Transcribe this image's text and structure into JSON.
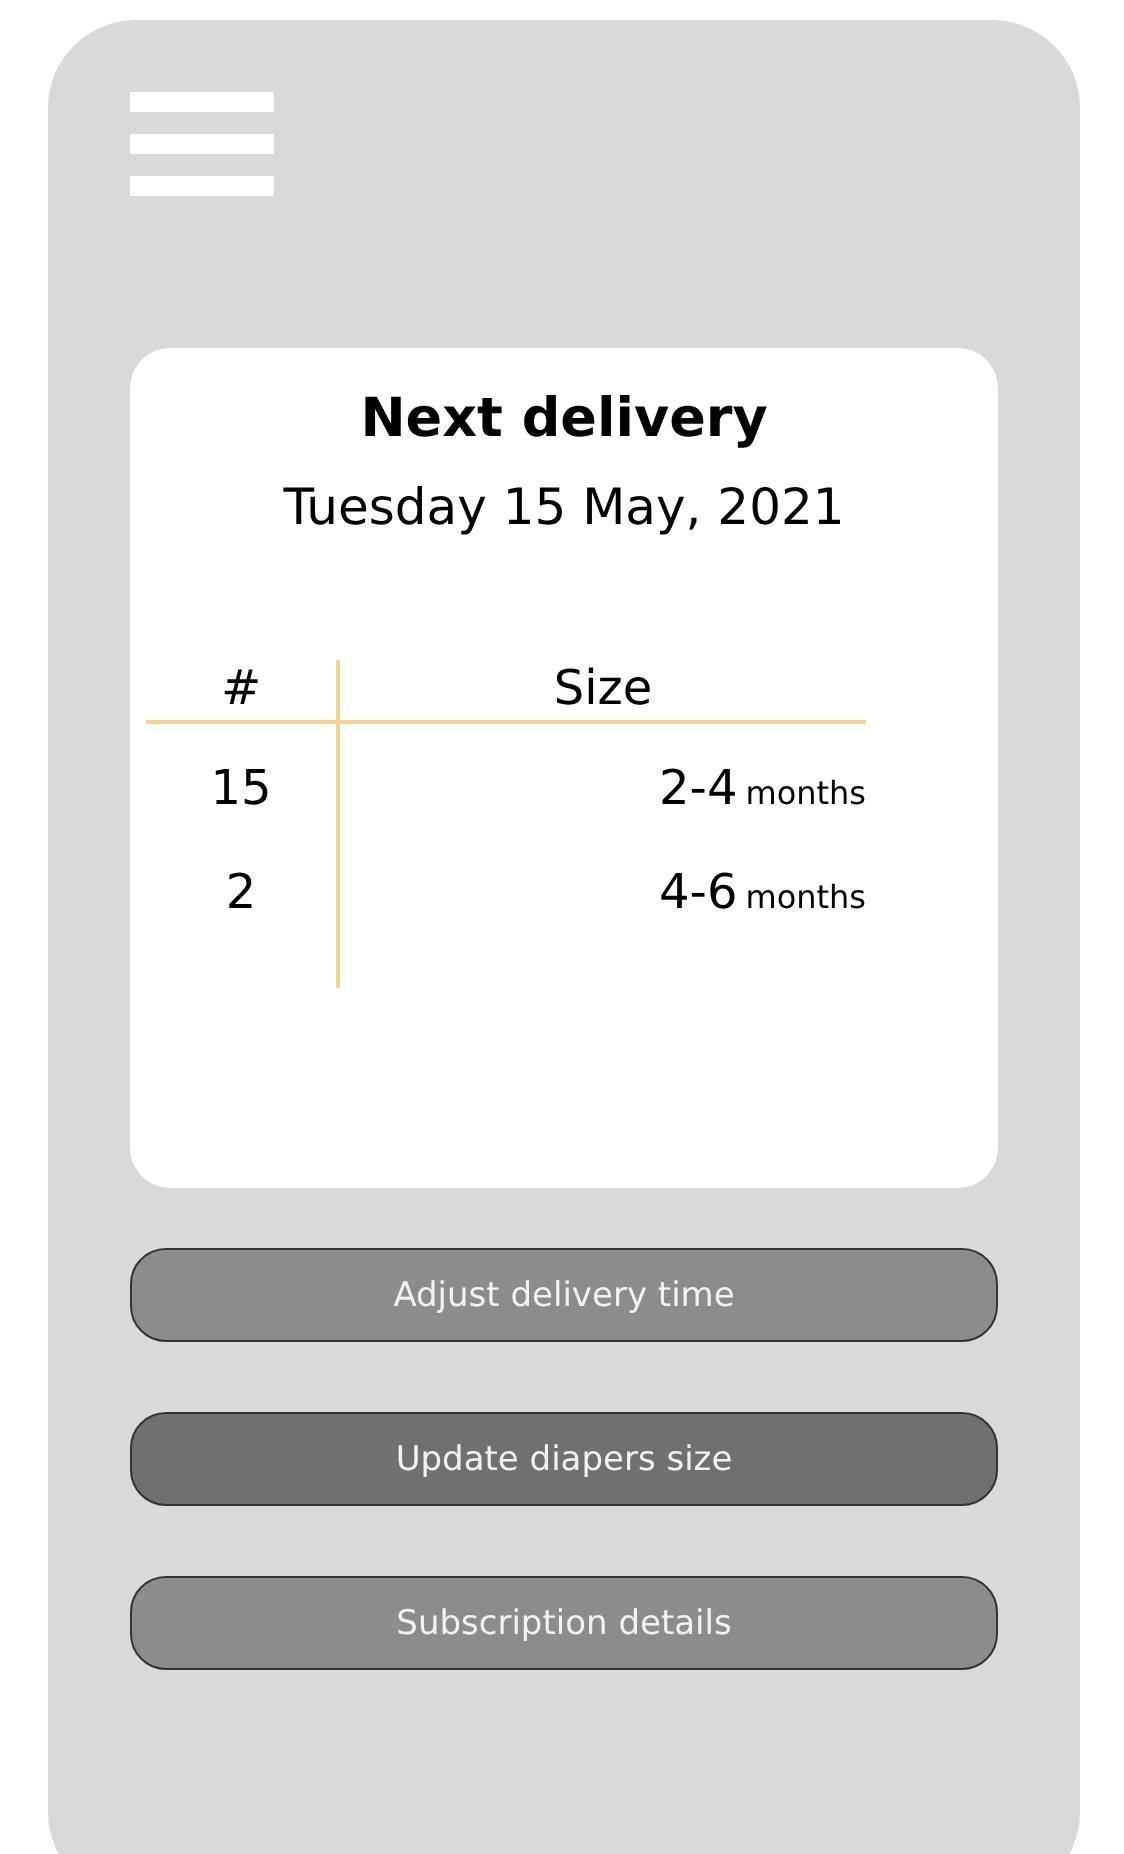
{
  "card": {
    "title": "Next delivery",
    "date": "Tuesday 15 May, 2021",
    "table": {
      "columns": [
        "#",
        "Size"
      ],
      "rows": [
        {
          "count": "15",
          "size": "2-4",
          "unit": "months"
        },
        {
          "count": "2",
          "size": "4-6",
          "unit": "months"
        }
      ]
    }
  },
  "buttons": [
    {
      "label": "Adjust delivery time",
      "selected": false
    },
    {
      "label": "Update diapers size",
      "selected": true
    },
    {
      "label": "Subscription details",
      "selected": false
    }
  ]
}
